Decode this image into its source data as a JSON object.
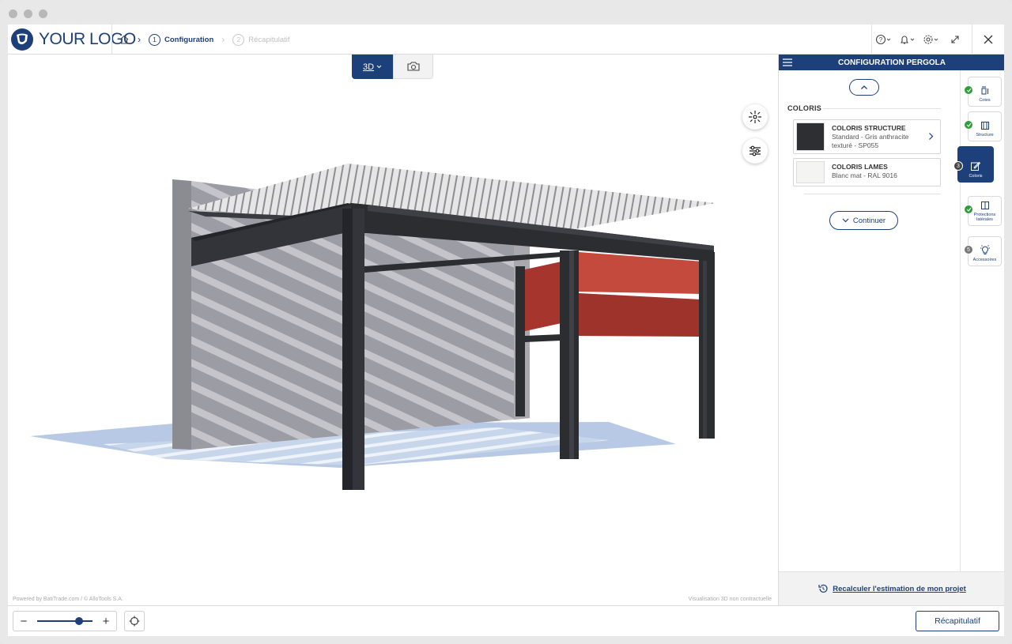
{
  "header": {
    "logo_text": "YOUR LOGO",
    "steps": [
      {
        "num": "1",
        "label": "Configuration"
      },
      {
        "num": "2",
        "label": "Récapitulatif"
      }
    ]
  },
  "viewport": {
    "view_tab_label": "3D",
    "powered_text": "Powered by BatiTrade.com / © AlloTools S.A.",
    "disclaimer": "Visualisation 3D non contractuelle"
  },
  "bottombar": {
    "zoom_level": 0.8,
    "recap_label": "Récapitulatif"
  },
  "panel": {
    "title": "CONFIGURATION PERGOLA",
    "section_title": "COLORIS",
    "cards": [
      {
        "name": "COLORIS STRUCTURE",
        "value_line1": "Standard - Gris anthracite",
        "value_line2": "texturé - SP055",
        "color": "#2e2f33"
      },
      {
        "name": "COLORIS LAMES",
        "value_line1": "Blanc mat - RAL 9016",
        "value_line2": "",
        "color": "#f4f4f2"
      }
    ],
    "continue_label": "Continuer",
    "recalc_label": "Recalculer l'estimation de mon projet",
    "steps": [
      {
        "label": "Cotes",
        "badge": "check"
      },
      {
        "label": "Structure",
        "badge": "check"
      },
      {
        "label": "Coloris",
        "badge": "3"
      },
      {
        "label": "Protections latérales",
        "badge": "check"
      },
      {
        "label": "Accessoires",
        "badge": "5"
      }
    ]
  },
  "colors": {
    "brand": "#1d3f7a",
    "check": "#2e9e3a",
    "fabric": "#c44a3e"
  }
}
